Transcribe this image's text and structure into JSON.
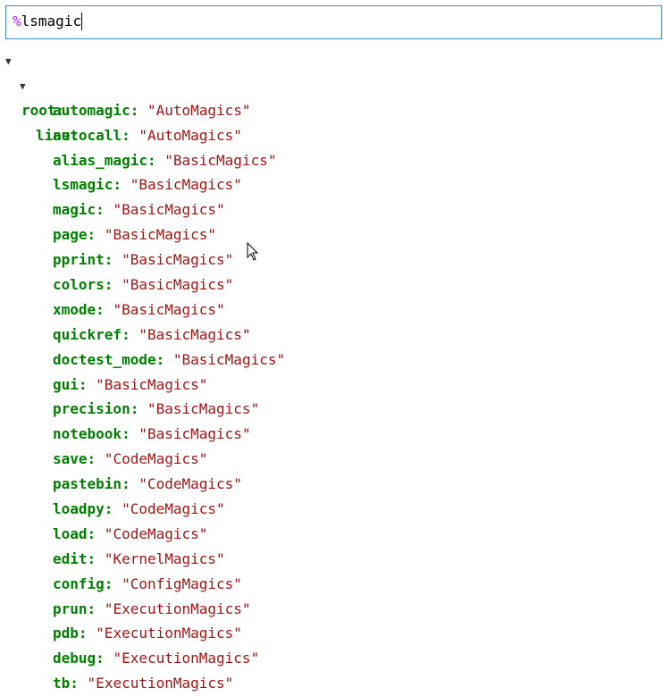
{
  "input": {
    "prefix": "%",
    "text": "lsmagic"
  },
  "tree": {
    "root_label": "root:",
    "line_label": "line:",
    "expand_glyph": "▼",
    "items": [
      {
        "key": "automagic:",
        "value": "\"AutoMagics\""
      },
      {
        "key": "autocall:",
        "value": "\"AutoMagics\""
      },
      {
        "key": "alias_magic:",
        "value": "\"BasicMagics\""
      },
      {
        "key": "lsmagic:",
        "value": "\"BasicMagics\""
      },
      {
        "key": "magic:",
        "value": "\"BasicMagics\""
      },
      {
        "key": "page:",
        "value": "\"BasicMagics\""
      },
      {
        "key": "pprint:",
        "value": "\"BasicMagics\""
      },
      {
        "key": "colors:",
        "value": "\"BasicMagics\""
      },
      {
        "key": "xmode:",
        "value": "\"BasicMagics\""
      },
      {
        "key": "quickref:",
        "value": "\"BasicMagics\""
      },
      {
        "key": "doctest_mode:",
        "value": "\"BasicMagics\""
      },
      {
        "key": "gui:",
        "value": "\"BasicMagics\""
      },
      {
        "key": "precision:",
        "value": "\"BasicMagics\""
      },
      {
        "key": "notebook:",
        "value": "\"BasicMagics\""
      },
      {
        "key": "save:",
        "value": "\"CodeMagics\""
      },
      {
        "key": "pastebin:",
        "value": "\"CodeMagics\""
      },
      {
        "key": "loadpy:",
        "value": "\"CodeMagics\""
      },
      {
        "key": "load:",
        "value": "\"CodeMagics\""
      },
      {
        "key": "edit:",
        "value": "\"KernelMagics\""
      },
      {
        "key": "config:",
        "value": "\"ConfigMagics\""
      },
      {
        "key": "prun:",
        "value": "\"ExecutionMagics\""
      },
      {
        "key": "pdb:",
        "value": "\"ExecutionMagics\""
      },
      {
        "key": "debug:",
        "value": "\"ExecutionMagics\""
      },
      {
        "key": "tb:",
        "value": "\"ExecutionMagics\""
      }
    ]
  },
  "icons": {
    "pointer": "mouse-pointer-icon"
  }
}
